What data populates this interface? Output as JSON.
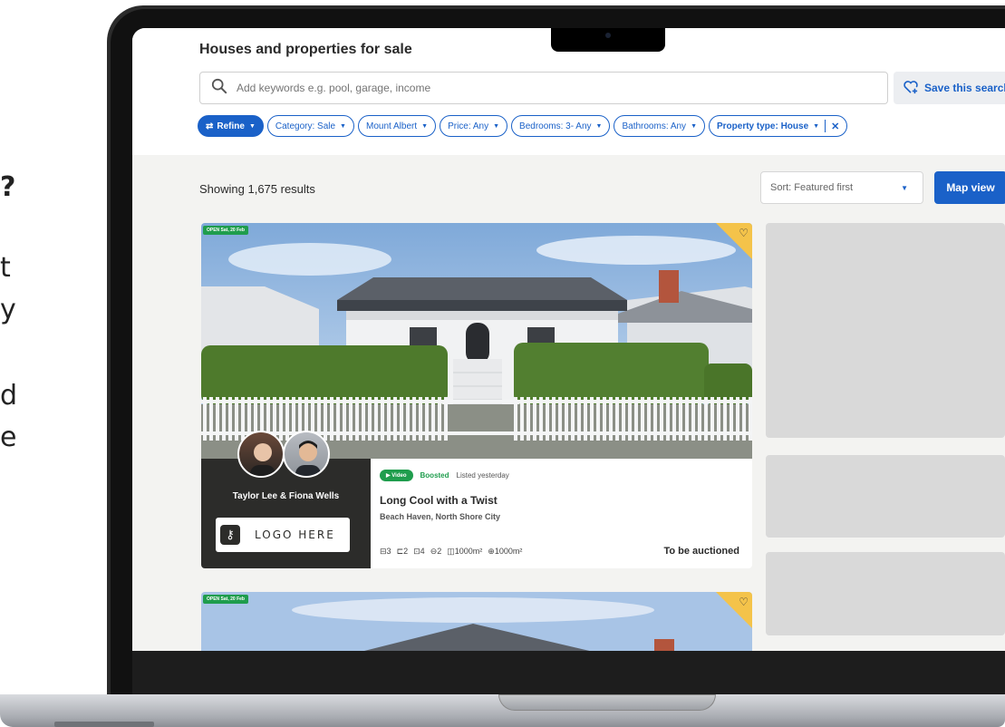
{
  "side_text": {
    "line1": "?",
    "line2": "t",
    "line3": "y",
    "line4": "d",
    "line5": "e"
  },
  "page": {
    "title": "Houses and properties for sale"
  },
  "search": {
    "placeholder": "Add keywords e.g. pool, garage, income",
    "save_label": "Save this search"
  },
  "filters": {
    "refine": "Refine",
    "category": "Category: Sale",
    "location": "Mount Albert",
    "price": "Price: Any",
    "bedrooms": "Bedrooms: 3- Any",
    "bathrooms": "Bathrooms: Any",
    "property_type": "Property type: House",
    "clear": "✕"
  },
  "results": {
    "count_label": "Showing 1,675 results",
    "sort_label": "Sort: Featured first",
    "map_view": "Map view"
  },
  "listing": {
    "open_badge": "OPEN Sat, 20 Feb",
    "agents": "Taylor Lee & Fiona Wells",
    "logo_text": "LOGO HERE",
    "video_badge": "▶ Video",
    "boosted": "Boosted",
    "listed": "Listed yesterday",
    "title": "Long Cool with a Twist",
    "location": "Beach Haven, North Shore City",
    "features": {
      "bedrooms": "3",
      "bathrooms": "2",
      "parking": "4",
      "garage": "2",
      "floor_area": "1000m²",
      "land_area": "1000m²"
    },
    "sale_method": "To be auctioned"
  },
  "listing2": {
    "open_badge": "OPEN Sat, 20 Feb"
  },
  "colors": {
    "accent": "#1a61c8",
    "green": "#1f9d4d",
    "favourite": "#f4c34a",
    "agent_panel": "#2c2c2a"
  }
}
